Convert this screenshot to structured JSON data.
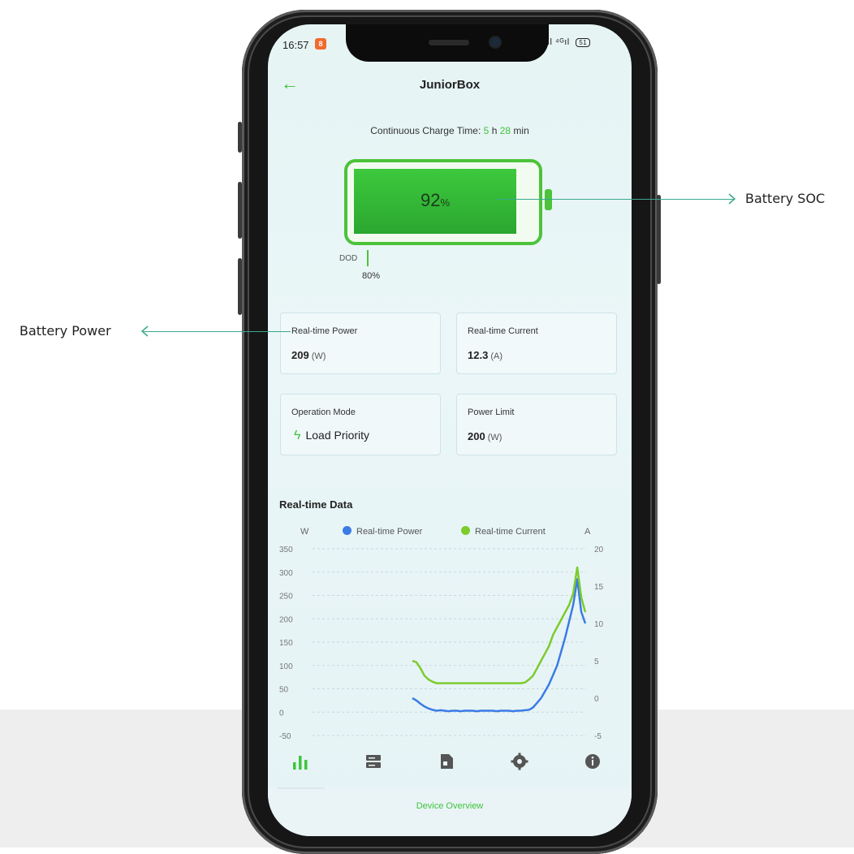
{
  "status": {
    "time": "16:57",
    "badge": "8",
    "signal": "ıl ⁴ᴳıl",
    "battery": "51"
  },
  "header": {
    "title": "JuniorBox"
  },
  "charge": {
    "prefix": "Continuous Charge Time:",
    "hours": "5",
    "h_unit": "h",
    "minutes": "28",
    "m_unit": "min"
  },
  "battery": {
    "soc": "92",
    "soc_unit": "%",
    "dod_label": "DOD",
    "dod_value": "80%"
  },
  "cards": {
    "power": {
      "label": "Real-time Power",
      "value": "209",
      "unit": "(W)"
    },
    "current": {
      "label": "Real-time Current",
      "value": "12.3",
      "unit": "(A)"
    },
    "mode": {
      "label": "Operation Mode",
      "value": "Load Priority"
    },
    "limit": {
      "label": "Power Limit",
      "value": "200",
      "unit": "(W)"
    }
  },
  "realtime": {
    "title": "Real-time Data",
    "unit_left": "W",
    "unit_right": "A",
    "legend_power": "Real-time Power",
    "legend_current": "Real-time Current"
  },
  "chart_data": {
    "type": "line",
    "title": "Real-time Data",
    "ylabel_left": "W",
    "ylabel_right": "A",
    "y_left_ticks": [
      "350",
      "300",
      "250",
      "200",
      "150",
      "100",
      "50",
      "0",
      "-50"
    ],
    "y_right_ticks": [
      "20",
      "15",
      "10",
      "5",
      "0",
      "-5"
    ],
    "ylim_left": [
      -50,
      350
    ],
    "ylim_right": [
      -5,
      20
    ],
    "grid": true,
    "legend": "top",
    "series": [
      {
        "name": "Real-time Power",
        "color": "#3b7be6",
        "values": [
          30,
          25,
          18,
          12,
          8,
          5,
          3,
          4,
          3,
          2,
          3,
          3,
          2,
          3,
          3,
          3,
          2,
          3,
          3,
          3,
          3,
          2,
          3,
          3,
          3,
          2,
          3,
          3,
          4,
          5,
          10,
          20,
          30,
          45,
          60,
          80,
          100,
          130,
          160,
          195,
          230,
          285,
          215,
          190
        ]
      },
      {
        "name": "Real-time Current",
        "color": "#7ccb2c",
        "values": [
          5.0,
          4.8,
          4.0,
          3.0,
          2.5,
          2.2,
          2.0,
          2.0,
          2.0,
          2.0,
          2.0,
          2.0,
          2.0,
          2.0,
          2.0,
          2.0,
          2.0,
          2.0,
          2.0,
          2.0,
          2.0,
          2.0,
          2.0,
          2.0,
          2.0,
          2.0,
          2.0,
          2.0,
          2.1,
          2.5,
          3.0,
          4.0,
          5.0,
          6.0,
          7.0,
          8.5,
          9.5,
          10.5,
          11.5,
          12.5,
          14.0,
          17.5,
          13.5,
          11.5
        ]
      }
    ]
  },
  "tabs": [
    "overview-icon",
    "device-list-icon",
    "report-icon",
    "settings-icon",
    "info-icon"
  ],
  "bottom": {
    "label": "Device Overview"
  },
  "annotations": {
    "soc": "Battery SOC",
    "power": "Battery Power"
  },
  "colors": {
    "accent": "#3ec43e",
    "power": "#3b7be6",
    "current": "#7ccb2c",
    "arrow": "#3aa88d"
  }
}
